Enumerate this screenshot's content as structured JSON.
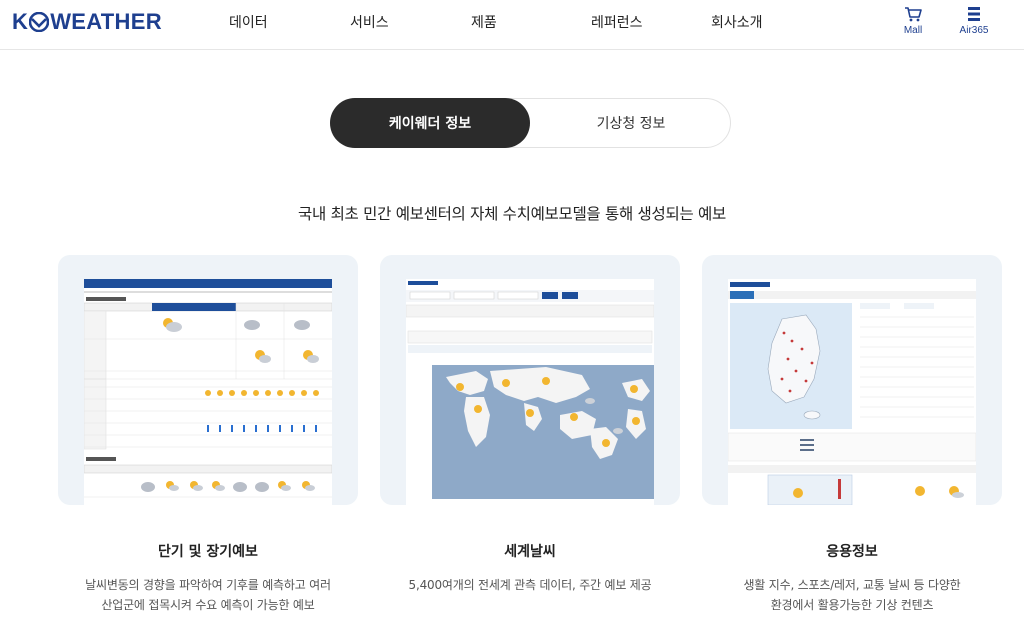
{
  "header": {
    "logo_text": "KOWEATHER",
    "nav": [
      "데이터",
      "서비스",
      "제품",
      "레퍼런스",
      "회사소개"
    ],
    "mall_label": "Mall",
    "air_label": "Air365"
  },
  "tabs": {
    "active": "케이웨더 정보",
    "inactive": "기상청 정보"
  },
  "headline": "국내 최초 민간 예보센터의 자체 수치예보모델을 통해 생성되는 예보",
  "cards": [
    {
      "title": "단기 및 장기예보",
      "desc_line1": "날씨변동의 경향을 파악하여 기후를 예측하고 여러",
      "desc_line2": "산업군에 접목시켜 수요 예측이 가능한 예보"
    },
    {
      "title": "세계날씨",
      "desc_line1": "5,400여개의 전세계 관측 데이터, 주간 예보 제공",
      "desc_line2": ""
    },
    {
      "title": "응용정보",
      "desc_line1": "생활 지수, 스포츠/레저, 교통 날씨 등 다양한",
      "desc_line2": "환경에서 활용가능한 기상 컨텐츠"
    }
  ],
  "colors": {
    "brand": "#1e3f8f",
    "tab_active_bg": "#2b2b2b",
    "card_bg": "#eef3f8"
  }
}
